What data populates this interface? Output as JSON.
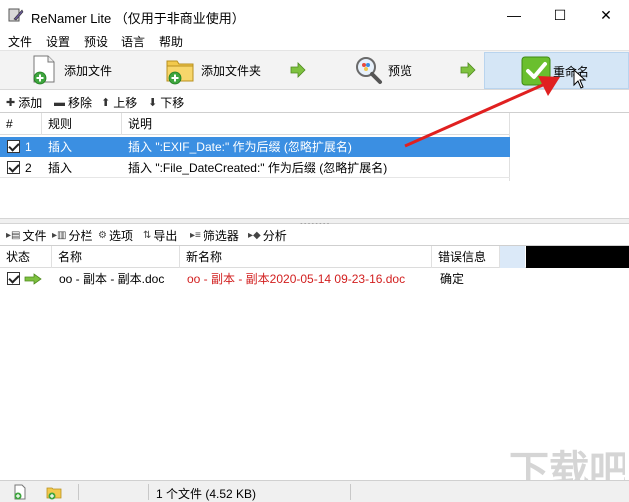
{
  "window": {
    "title": "ReNamer Lite （仅用于非商业使用）",
    "minimize_glyph": "—",
    "maximize_glyph": "☐",
    "close_glyph": "✕"
  },
  "menu": {
    "items": [
      "文件",
      "设置",
      "预设",
      "语言",
      "帮助"
    ]
  },
  "toolbar": {
    "add_files": "添加文件",
    "add_folder": "添加文件夹",
    "preview": "预览",
    "rename": "重命名"
  },
  "rules_toolbar": {
    "add": "添加",
    "remove": "移除",
    "move_up": "上移",
    "move_down": "下移"
  },
  "rules": {
    "columns": [
      "#",
      "规则",
      "说明"
    ],
    "rows": [
      {
        "num": "1",
        "rule": "插入",
        "desc": "插入 \":EXIF_Date:\" 作为后缀 (忽略扩展名)",
        "checked": true,
        "selected": true
      },
      {
        "num": "2",
        "rule": "插入",
        "desc": "插入 \":File_DateCreated:\" 作为后缀 (忽略扩展名)",
        "checked": true,
        "selected": false
      }
    ]
  },
  "files_toolbar": {
    "files": "文件",
    "columns": "分栏",
    "options": "选项",
    "export": "导出",
    "filter": "筛选器",
    "analyze": "分析"
  },
  "files": {
    "columns": [
      "状态",
      "名称",
      "新名称",
      "错误信息"
    ],
    "rows": [
      {
        "name": "oo - 副本 - 副本.doc",
        "new_name": "oo - 副本 - 副本2020-05-14 09-23-16.doc",
        "error": "确定",
        "checked": true
      }
    ]
  },
  "status": {
    "summary": "1 个文件 (4.52 KB)"
  },
  "colors": {
    "selection": "#3b8fe2",
    "new_name": "#d21f1f",
    "rename_button_bg": "#d5e6f6",
    "annotation_arrow": "#e02020"
  }
}
